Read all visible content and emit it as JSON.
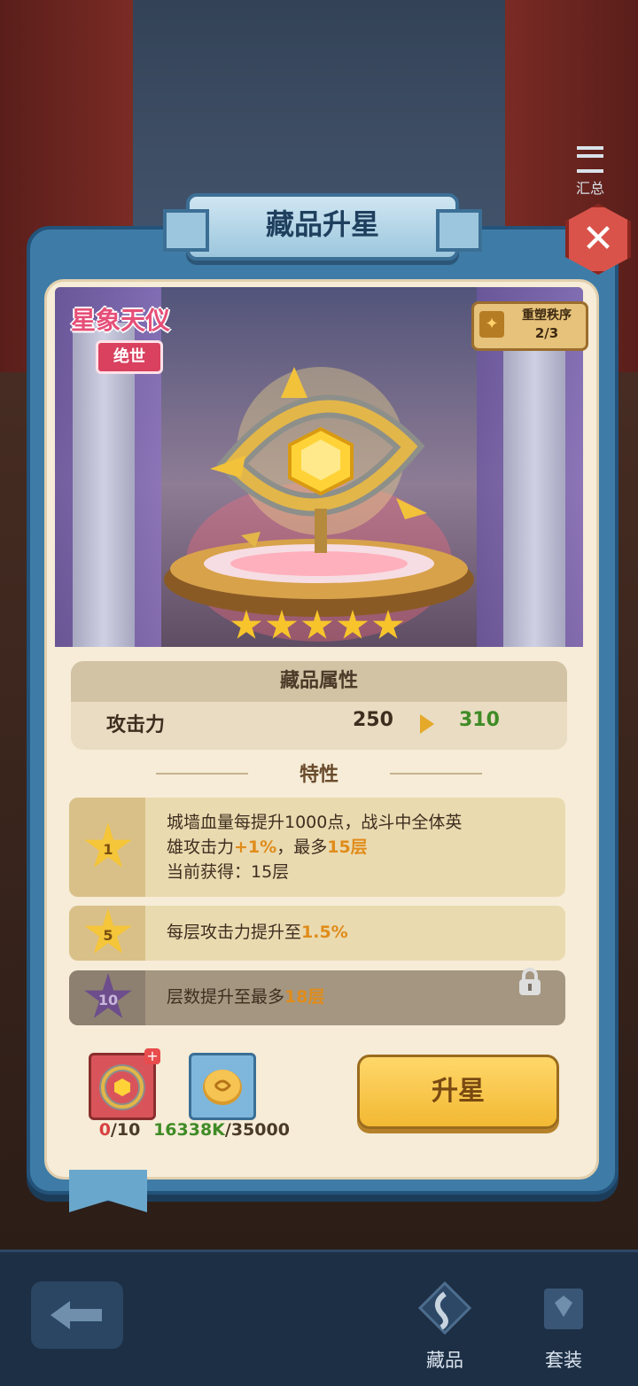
{
  "window": {
    "title": "藏品升星"
  },
  "top_right": {
    "summary_label": "汇总"
  },
  "item": {
    "name": "星象天仪",
    "rarity": "绝世",
    "reshape_label": "重塑秩序",
    "reshape_value": "2/3",
    "stars": 5
  },
  "attributes": {
    "header": "藏品属性",
    "name": "攻击力",
    "current": "250",
    "next": "310"
  },
  "traits": {
    "title": "特性",
    "items": [
      {
        "star_level": "1",
        "line1": "城墙血量每提升1000点，战斗中全体英",
        "line2_prefix": "雄攻击力",
        "line2_hl1": "+1%",
        "line2_mid": "，最多",
        "line2_hl2": "15层",
        "line3": "当前获得：15层"
      },
      {
        "star_level": "5",
        "prefix": "每层攻击力提升至",
        "highlight": "1.5%"
      },
      {
        "star_level": "10",
        "prefix": "层数提升至最多",
        "highlight": "18层",
        "locked": true
      }
    ]
  },
  "costs": {
    "item_have": "0",
    "item_need": "/10",
    "coin_have": "16338K",
    "coin_need": "/35000"
  },
  "upgrade_button": "升星",
  "nav": {
    "collection": "藏品",
    "set": "套装"
  },
  "colors": {
    "accent": "#f2b933",
    "panel": "#3e7ca7",
    "highlight": "#e08c1a",
    "green": "#3f8b26"
  }
}
